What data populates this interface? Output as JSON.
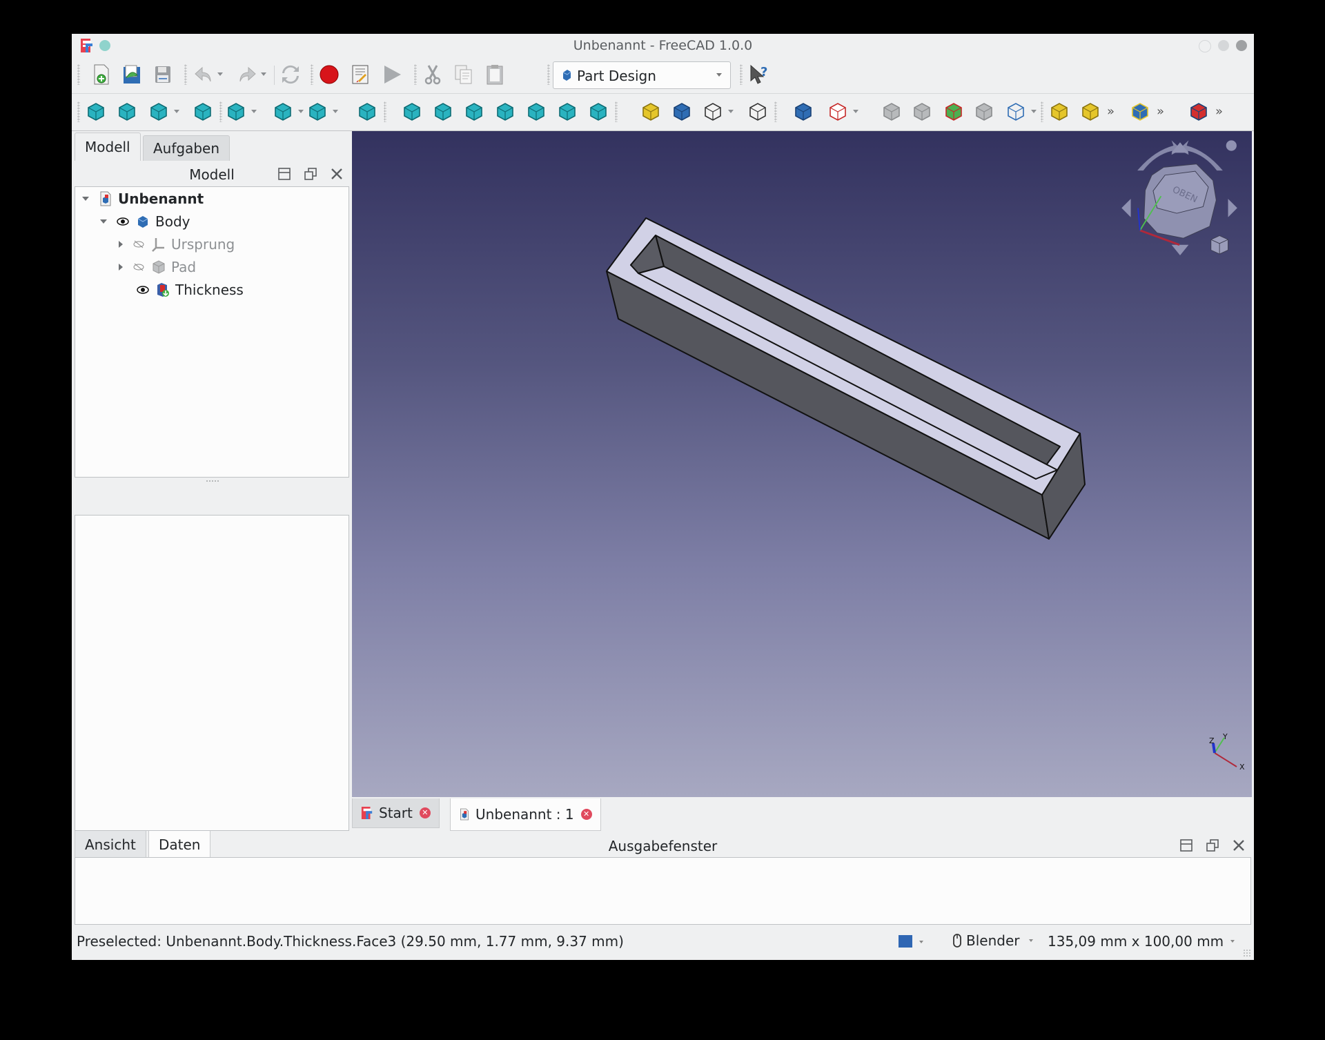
{
  "window": {
    "title": "Unbenannt - FreeCAD 1.0.0",
    "app_icon": "freecad-logo-icon"
  },
  "toolbar_top": {
    "items": [
      {
        "name": "new-document-icon"
      },
      {
        "name": "open-document-icon"
      },
      {
        "name": "save-document-icon"
      },
      {
        "name": "undo-icon",
        "dropdown": true
      },
      {
        "name": "redo-icon",
        "dropdown": true
      },
      {
        "name": "refresh-icon"
      },
      {
        "name": "macro-record-icon"
      },
      {
        "name": "macro-edit-icon"
      },
      {
        "name": "macro-run-icon"
      },
      {
        "name": "cut-icon"
      },
      {
        "name": "copy-icon"
      },
      {
        "name": "paste-icon"
      },
      {
        "name": "whats-this-icon"
      }
    ],
    "workbench_selector": {
      "selected": "Part Design"
    }
  },
  "toolbar_view": {
    "items": [
      "fit-all-icon",
      "fit-selection-icon",
      "isometric-view-icon",
      "std-view-icon",
      "draw-style-icon",
      "bounding-box-icon",
      "zoom-icon",
      "measure-icon",
      "view-iso-icon",
      "view-front-icon",
      "view-top-icon",
      "view-right-icon",
      "view-rear-icon",
      "view-bottom-icon",
      "view-left-icon",
      "part-icon",
      "group-icon",
      "link-icon",
      "variable-set-icon",
      "create-body-icon",
      "shape-binder-icon",
      "clone-icon",
      "datum-figure-icon",
      "sketch-icon",
      "sub-shape-binder-icon",
      "datum-plane-icon",
      "pad-icon",
      "revolution-icon",
      "pocket-icon",
      "fillet-icon"
    ]
  },
  "left_panel": {
    "tabs": [
      {
        "label": "Modell",
        "active": true
      },
      {
        "label": "Aufgaben",
        "active": false
      }
    ],
    "dock_title": "Modell",
    "tree": [
      {
        "label": "Unbenannt",
        "level": 0,
        "expanded": true,
        "bold": true,
        "icon": "document-icon"
      },
      {
        "label": "Body",
        "level": 1,
        "expanded": true,
        "visible": true,
        "icon": "body-icon"
      },
      {
        "label": "Ursprung",
        "level": 2,
        "expanded": false,
        "visible": false,
        "icon": "origin-icon",
        "dimmed": true
      },
      {
        "label": "Pad",
        "level": 2,
        "expanded": false,
        "visible": false,
        "icon": "pad-feature-icon",
        "dimmed": true
      },
      {
        "label": "Thickness",
        "level": 2,
        "visible": true,
        "icon": "thickness-feature-icon"
      }
    ],
    "bottom_tabs": [
      {
        "label": "Ansicht",
        "active": false
      },
      {
        "label": "Daten",
        "active": true
      }
    ]
  },
  "viewport": {
    "navcube_face_label": "OBEN",
    "axis_labels": [
      "X",
      "Y",
      "Z"
    ]
  },
  "doc_tabs": [
    {
      "label": "Start",
      "active": false
    },
    {
      "label": "Unbenannt : 1",
      "active": true
    }
  ],
  "output": {
    "title": "Ausgabefenster",
    "content": ""
  },
  "statusbar": {
    "message": "Preselected: Unbenannt.Body.Thickness.Face3 (29.50 mm, 1.77 mm, 9.37 mm)",
    "navigation_style": "Blender",
    "dimensions": "135,09 mm x 100,00 mm"
  }
}
